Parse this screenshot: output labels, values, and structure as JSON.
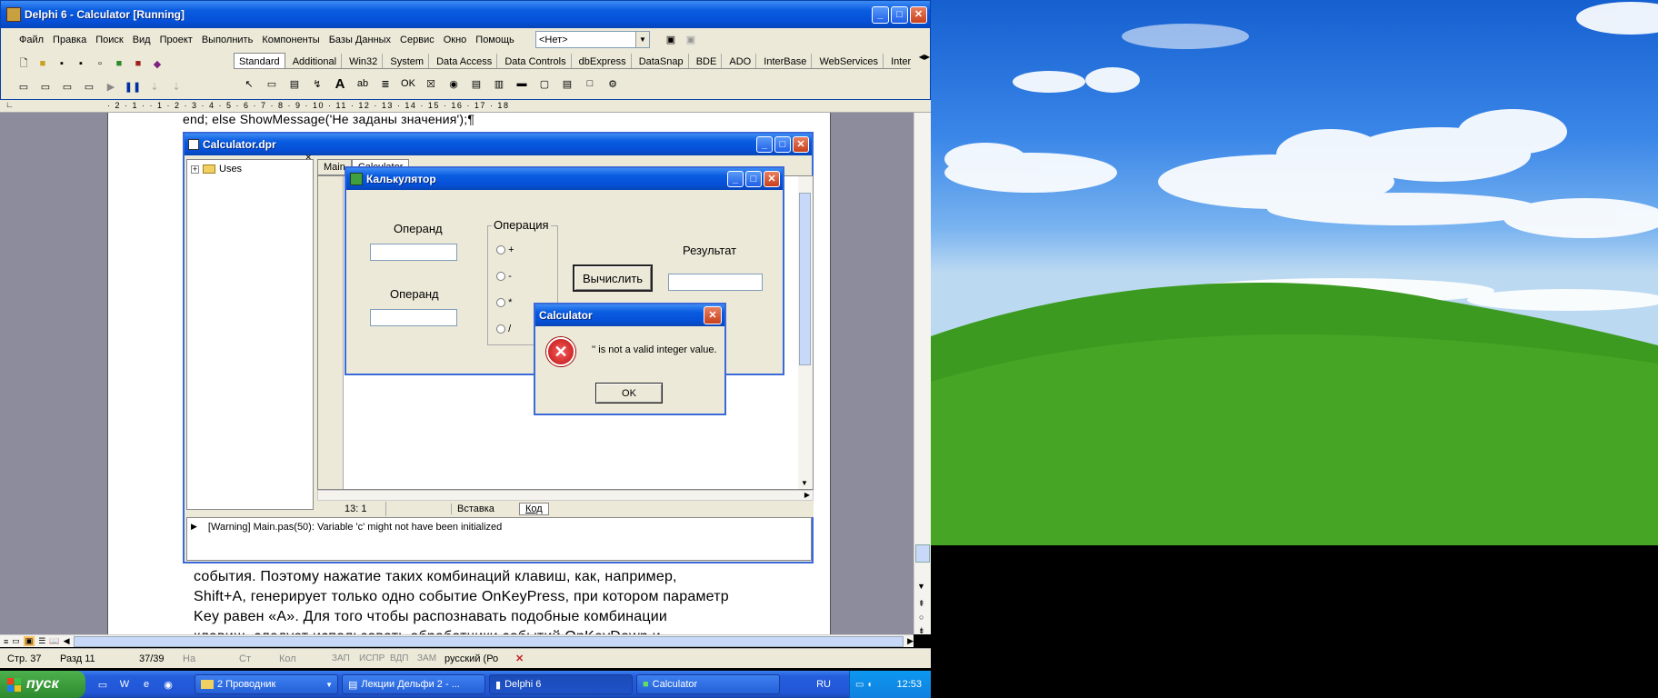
{
  "delphi": {
    "title": "Delphi 6 - Calculator [Running]",
    "menu": [
      "Файл",
      "Правка",
      "Поиск",
      "Вид",
      "Проект",
      "Выполнить",
      "Компоненты",
      "Базы Данных",
      "Сервис",
      "Окно",
      "Помощь"
    ],
    "combo_value": "<Нет>",
    "palette_tabs": [
      "Standard",
      "Additional",
      "Win32",
      "System",
      "Data Access",
      "Data Controls",
      "dbExpress",
      "DataSnap",
      "BDE",
      "ADO",
      "InterBase",
      "WebServices",
      "Internet"
    ]
  },
  "word": {
    "code_line": "end; else ShowMessage('Не заданы значения');¶",
    "paragraph": [
      "события. Поэтому нажатие таких комбинаций клавиш, как, например,",
      "Shift+A, генерирует только одно событие OnKeyPress, при котором параметр",
      "Key равен «A». Для того чтобы распознавать подобные комбинации",
      "клавиш, следует использовать обработчики событий OnKeyDown и"
    ],
    "ruler": "· 2 · 1 · · 1 · 2 · 3 · 4 · 5 · 6 · 7 · 8 · 9 · 10 · 11 · 12 · 13 · 14 · 15 · 16 · 17 · 18",
    "status": {
      "page": "Стр. 37",
      "section": "Разд 11",
      "count": "37/39",
      "at": "На",
      "line": "Ст",
      "col": "Кол",
      "rec": "ЗАП",
      "trk": "ИСПР",
      "ext": "ВДП",
      "ovr": "ЗАМ",
      "lang": "русский (Ро"
    }
  },
  "project": {
    "title": "Calculator.dpr",
    "tree_item": "Uses",
    "tabs": [
      "Main",
      "Calculator"
    ],
    "pos": "13: 1",
    "mode": "Вставка",
    "code_tab": "Код",
    "message": "[Warning] Main.pas(50): Variable 'c' might not have been initialized"
  },
  "calc": {
    "title": "Калькулятор",
    "operand1_label": "Операнд",
    "operand2_label": "Операнд",
    "operation_label": "Операция",
    "ops": [
      "+",
      "-",
      "*",
      "/"
    ],
    "compute_label": "Вычислить",
    "result_label": "Результат"
  },
  "dialog": {
    "title": "Calculator",
    "message": "'' is not a valid integer value.",
    "ok": "OK"
  },
  "taskbar": {
    "start": "пуск",
    "items": [
      "2 Проводник",
      "Лекции Дельфи 2 - ...",
      "Delphi 6",
      "Calculator"
    ],
    "lang": "RU",
    "time": "12:53"
  }
}
